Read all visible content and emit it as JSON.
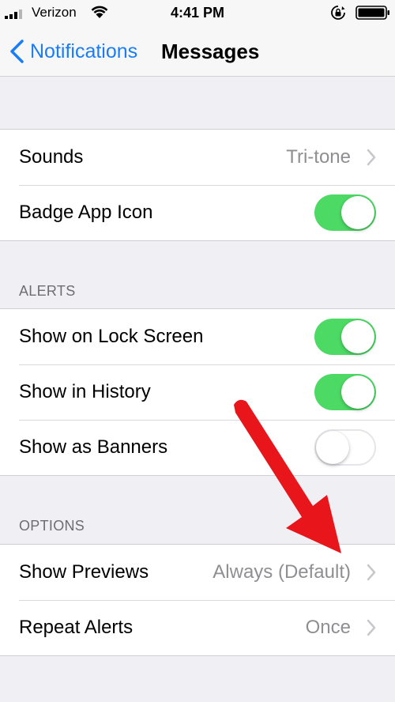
{
  "status_bar": {
    "carrier": "Verizon",
    "time": "4:41 PM"
  },
  "nav": {
    "back_label": "Notifications",
    "title": "Messages"
  },
  "groups": {
    "general": [
      {
        "label": "Sounds",
        "value": "Tri-tone"
      },
      {
        "label": "Badge App Icon",
        "toggle": true
      }
    ],
    "alerts_header": "ALERTS",
    "alerts": [
      {
        "label": "Show on Lock Screen",
        "toggle": true
      },
      {
        "label": "Show in History",
        "toggle": true
      },
      {
        "label": "Show as Banners",
        "toggle": false
      }
    ],
    "options_header": "OPTIONS",
    "options": [
      {
        "label": "Show Previews",
        "value": "Always (Default)"
      },
      {
        "label": "Repeat Alerts",
        "value": "Once"
      }
    ]
  },
  "colors": {
    "accent": "#1a7df6",
    "toggle_on": "#4cd964",
    "annotation_arrow": "#e8161b"
  },
  "icons": {
    "back": "chevron-left-icon",
    "disclosure": "chevron-right-icon",
    "signal": "cellular-signal-icon",
    "wifi": "wifi-icon",
    "rotation_lock": "rotation-lock-icon",
    "battery": "battery-icon"
  }
}
